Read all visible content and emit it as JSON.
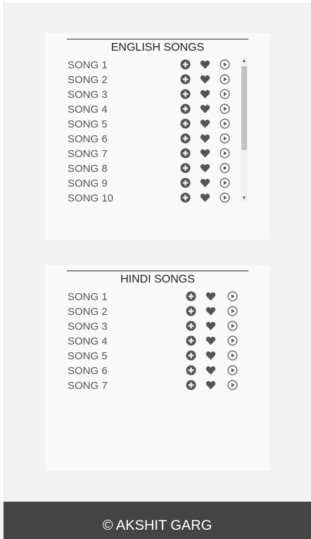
{
  "english": {
    "title": "ENGLISH SONGS",
    "songs": [
      "SONG 1",
      "SONG 2",
      "SONG 3",
      "SONG 4",
      "SONG 5",
      "SONG 6",
      "SONG 7",
      "SONG 8",
      "SONG 9",
      "SONG 10"
    ]
  },
  "hindi": {
    "title": "HINDI SONGS",
    "songs": [
      "SONG 1",
      "SONG 2",
      "SONG 3",
      "SONG 4",
      "SONG 5",
      "SONG 6",
      "SONG 7"
    ]
  },
  "footer": {
    "text": "© AKSHIT GARG"
  },
  "colors": {
    "icon": "#555555",
    "footer_bg": "#444444",
    "card_bg": "#f9f9f9",
    "page_bg": "#f2f2f2"
  },
  "icons": {
    "add": "plus-circle-icon",
    "favorite": "heart-icon",
    "play": "play-circle-icon"
  }
}
